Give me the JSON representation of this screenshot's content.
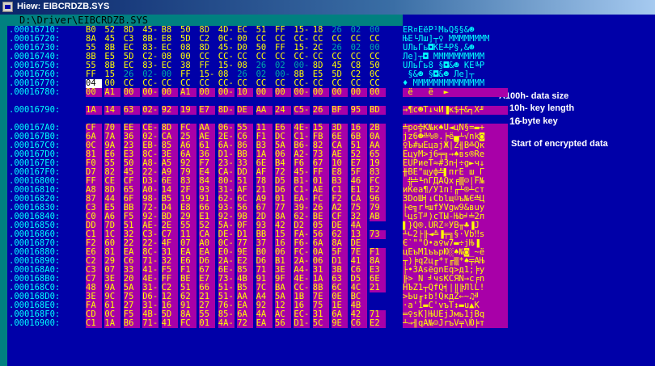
{
  "window": {
    "title": "Hiew: EIBCRDZB.SYS",
    "file_path": "D:\\Driver\\EIBCRDZB.SYS"
  },
  "colors": {
    "background": "#0000a8",
    "address": "#00ffff",
    "bytes": "#ffff00",
    "highlight": "#a800a8",
    "path_bar": "#008080"
  },
  "rows": [
    {
      "addr": ".00016710:",
      "bytes": [
        "B0",
        "52",
        "8D",
        "45-",
        "B8",
        "50",
        "8D",
        "4D-",
        "EC",
        "51",
        "FF",
        "15-",
        "18",
        "26",
        "02",
        "00"
      ],
      "dim": [
        13,
        14,
        15
      ],
      "ascii": "ЁR¤EёP¹MьQ§§&☻",
      "hl": false
    },
    {
      "addr": ".00016720:",
      "bytes": [
        "8A",
        "45",
        "C3",
        "8B-",
        "E8",
        "5D",
        "C2",
        "0C-",
        "00",
        "CC",
        "CC",
        "CC-",
        "CC",
        "CC",
        "CC",
        "CC"
      ],
      "dim": [],
      "ascii": "ЊE└Лш]┬♀ ММММММММ",
      "hl": false
    },
    {
      "addr": ".00016730:",
      "bytes": [
        "55",
        "8B",
        "EC",
        "83-",
        "EC",
        "08",
        "8D",
        "45-",
        "D0",
        "50",
        "FF",
        "15-",
        "2C",
        "26",
        "02",
        "00"
      ],
      "dim": [
        13,
        14,
        15
      ],
      "ascii": "UЛьГь◘ЌE╨P§,&☻",
      "hl": false
    },
    {
      "addr": ".00016740:",
      "bytes": [
        "8B",
        "E5",
        "5D",
        "C2-",
        "08",
        "00",
        "CC",
        "CC-",
        "CC",
        "CC",
        "CC",
        "CC-",
        "CC",
        "CC",
        "CC",
        "CC"
      ],
      "dim": [],
      "ascii": "Лe]┬◘ ММММММММММ",
      "hl": false
    },
    {
      "addr": ".00016750:",
      "bytes": [
        "55",
        "8B",
        "EC",
        "83-",
        "EC",
        "38",
        "FF",
        "15-",
        "08",
        "26",
        "02",
        "00-",
        "8D",
        "45",
        "C8",
        "50"
      ],
      "dim": [
        9,
        10,
        11
      ],
      "ascii": "UЛьГь8 §◘&☻ ЌE╚P",
      "hl": false
    },
    {
      "addr": ".00016760:",
      "bytes": [
        "FF",
        "15",
        "26",
        "02-",
        "00",
        "FF",
        "15-",
        "08",
        "26",
        "02",
        "00-",
        "8B",
        "E5",
        "5D",
        "C2",
        "0C"
      ],
      "dim": [
        2,
        3,
        4,
        8,
        9,
        10
      ],
      "ascii": " §&☻ §◘&☻ Лe]┬",
      "hl": false
    },
    {
      "addr": ".00016770:",
      "bytes": [
        "04",
        "00",
        "CC",
        "CC-",
        "CC",
        "CC",
        "CC",
        "CC-",
        "CC",
        "CC",
        "CC",
        "CC-",
        "CC",
        "CC",
        "CC",
        "CC"
      ],
      "dim": [],
      "cursor": 0,
      "ascii": "♦ ММММММММММММММ",
      "hl": false
    },
    {
      "addr": ".00016780:",
      "bytes": [
        "00",
        "A1",
        "00",
        "00-",
        "00",
        "A1",
        "00",
        "00-",
        "10",
        "00",
        "00",
        "00-",
        "00",
        "00",
        "00",
        "00"
      ],
      "dim": [],
      "ascii": " ё   ё  ►       ",
      "hl": true
    },
    {
      "addr": ".00016790:",
      "bytes": [
        "1A",
        "14",
        "63",
        "02-",
        "92",
        "19",
        "E7",
        "8D-",
        "DE",
        "AA",
        "24",
        "C5-",
        "26",
        "BF",
        "95",
        "BD"
      ],
      "dim": [],
      "ascii": "→¶c☻Т↓чЍ▐к$┼&┐Х╜",
      "hl": true,
      "gap": true
    },
    {
      "addr": ".000167A0:",
      "bytes": [
        "CF",
        "70",
        "EE",
        "CE-",
        "8D",
        "FC",
        "AA",
        "06-",
        "55",
        "11",
        "E6",
        "4E-",
        "15",
        "3D",
        "16",
        "2B"
      ],
      "dim": [],
      "ascii": "╧po╬Ќ№к♠U◄цN§=▬+",
      "hl": true,
      "gap": true
    },
    {
      "addr": ".000167B0:",
      "bytes": [
        "6A",
        "7A",
        "36",
        "02-",
        "CA",
        "25",
        "AE",
        "2E-",
        "C6",
        "F1",
        "DC",
        "C1-",
        "FB",
        "6E",
        "6B",
        "0A"
      ],
      "dim": [],
      "ascii": "jz6☻╩%®.╞ё▄┴√nk◙",
      "hl": true
    },
    {
      "addr": ".000167C0:",
      "bytes": [
        "0C",
        "9A",
        "23",
        "EB-",
        "85",
        "A6",
        "61",
        "6A-",
        "86",
        "B3",
        "5A",
        "B6-",
        "82",
        "CA",
        "51",
        "AA"
      ],
      "dim": [],
      "ascii": "♀Ъ#ыЕцajЖ│Z╢В╩Qк",
      "hl": true
    },
    {
      "addr": ".000167D0:",
      "bytes": [
        "81",
        "E6",
        "E3",
        "8C-",
        "3E",
        "6A",
        "36",
        "D1-",
        "BB",
        "1A",
        "06",
        "A2-",
        "73",
        "AE",
        "52",
        "65"
      ],
      "dim": [],
      "ascii": "ЁцуМ>j6╤╗→♠вs®Re",
      "hl": true
    },
    {
      "addr": ".000167E0:",
      "bytes": [
        "F0",
        "55",
        "50",
        "A8-",
        "A5",
        "92",
        "F7",
        "23-",
        "33",
        "6E",
        "B4",
        "F6",
        "67",
        "10",
        "E7",
        "19"
      ],
      "dim": [],
      "ascii": "ЁUPиеТ≈#3n┤÷g►ч↓",
      "hl": true
    },
    {
      "addr": ".000167F0:",
      "bytes": [
        "D7",
        "82",
        "45",
        "22-",
        "A9",
        "79",
        "E4",
        "CA-",
        "DD",
        "AF",
        "72",
        "45-",
        "FF",
        "E8",
        "5F",
        "83"
      ],
      "dim": [],
      "ascii": "╫ВE\"щyф╩▌пrE ш_Г",
      "hl": true
    },
    {
      "addr": ".00016800:",
      "bytes": [
        "FF",
        "CE",
        "CF",
        "D3-",
        "6E",
        "83",
        "84",
        "80-",
        "51",
        "78",
        "D5",
        "B1-",
        "01",
        "B3",
        "46",
        "FC"
      ],
      "dim": [],
      "ascii": " ╬╧╙nГДАQx╒▒☺│F№",
      "hl": true
    },
    {
      "addr": ".00016810:",
      "bytes": [
        "A8",
        "8D",
        "65",
        "A0-",
        "14",
        "2F",
        "93",
        "31-",
        "AF",
        "21",
        "D6",
        "C1-",
        "AE",
        "C1",
        "E1",
        "E2"
      ],
      "dim": [],
      "ascii": "иЌeа¶/У1п!╓┴®┴ст",
      "hl": true
    },
    {
      "addr": ".00016820:",
      "bytes": [
        "87",
        "44",
        "6F",
        "98-",
        "B5",
        "19",
        "91",
        "62-",
        "6C",
        "A9",
        "01",
        "EA-",
        "FC",
        "F2",
        "CA",
        "96"
      ],
      "dim": [],
      "ascii": "ЗDoШ╡↓Сblщ☺ъ№Є╩Ц",
      "hl": true
    },
    {
      "addr": ".00016830:",
      "bytes": [
        "C3",
        "E5",
        "BB",
        "72-",
        "D4",
        "E8",
        "66",
        "93-",
        "56",
        "67",
        "77",
        "39-",
        "26",
        "A2",
        "75",
        "79"
      ],
      "dim": [],
      "ascii": "├e╗r╘шfУVgw9&вuy",
      "hl": true
    },
    {
      "addr": ".00016840:",
      "bytes": [
        "C0",
        "A6",
        "F5",
        "92-",
        "BD",
        "29",
        "E1",
        "92-",
        "9B",
        "2D",
        "8A",
        "62-",
        "BE",
        "CF",
        "32",
        "AB"
      ],
      "dim": [],
      "ascii": "└цѕТ╜)сТЫ-Њb╛╧2л",
      "hl": true
    },
    {
      "addr": ".00016850:",
      "bytes": [
        "DD",
        "7D",
        "51",
        "AE-",
        "2E",
        "55",
        "52",
        "5A-",
        "0F",
        "93",
        "42",
        "D2",
        "05",
        "DE",
        "4A"
      ],
      "dim": [],
      "ascii": "▌}Q®.URZ☼УB╥♣▐J",
      "hl": true
    },
    {
      "addr": ".00016860:",
      "bytes": [
        "C1",
        "1C",
        "32",
        "C3-",
        "C7",
        "11",
        "CA",
        "DE-",
        "D1",
        "BB",
        "15",
        "FA-",
        "56",
        "62",
        "13",
        "73"
      ],
      "dim": [],
      "ascii": "┴∟2├╟◄╩▐╤╗§·Vb‼s",
      "hl": true
    },
    {
      "addr": ".00016870:",
      "bytes": [
        "F2",
        "60",
        "22",
        "22-",
        "4F",
        "07",
        "A0",
        "0C-",
        "77",
        "37",
        "16",
        "F6-",
        "6A",
        "8A",
        "DE"
      ],
      "dim": [],
      "ascii": "Є`\"\"O•а♀w7▬÷jЊ▐",
      "hl": true
    },
    {
      "addr": ".00016880:",
      "bytes": [
        "E6",
        "81",
        "EA",
        "8C-",
        "31",
        "EA",
        "EA",
        "E0-",
        "9E",
        "B0",
        "06",
        "FC-",
        "0A",
        "5F",
        "7E",
        "F1"
      ],
      "dim": [],
      "ascii": "цЁъМ1ъърЮ░♠№◙_~ё",
      "hl": true
    },
    {
      "addr": ".00016890:",
      "bytes": [
        "C2",
        "29",
        "C6",
        "71-",
        "32",
        "E6",
        "D6",
        "2A-",
        "E2",
        "D6",
        "B1",
        "2A-",
        "06",
        "D1",
        "41",
        "8A"
      ],
      "dim": [],
      "ascii": "┬)╞q2ц╓*т╓▒*♠╤AЊ",
      "hl": true
    },
    {
      "addr": ".000168A0:",
      "bytes": [
        "C3",
        "07",
        "33",
        "41-",
        "F5",
        "F1",
        "67",
        "6E-",
        "85",
        "71",
        "3E",
        "A4-",
        "31",
        "3B",
        "C6",
        "E3"
      ],
      "dim": [],
      "ascii": "├•3AѕёgnЕq>д1;╞у",
      "hl": true
    },
    {
      "addr": ".000168B0:",
      "bytes": [
        "C7",
        "3E",
        "20",
        "4E-",
        "FF",
        "BE",
        "E7",
        "73-",
        "4B",
        "91",
        "9F",
        "4E-",
        "1A",
        "63",
        "D5",
        "6E"
      ],
      "dim": [],
      "ascii": "╟> N ╛чsKСЯN→c╒n",
      "hl": true
    },
    {
      "addr": ".000168C0:",
      "bytes": [
        "48",
        "9A",
        "5A",
        "31-",
        "C2",
        "51",
        "66",
        "51-",
        "B5",
        "7C",
        "BA",
        "CC-",
        "8B",
        "6C",
        "4C",
        "21"
      ],
      "dim": [],
      "ascii": "HЪZ1┬QfQ╡|║╠ЛlL!",
      "hl": true
    },
    {
      "addr": ".000168D0:",
      "bytes": [
        "3E",
        "9C",
        "75",
        "D6-",
        "12",
        "62",
        "21",
        "51-",
        "AA",
        "A4",
        "5A",
        "1B",
        "7E",
        "0E",
        "BC"
      ],
      "dim": [],
      "ascii": ">Ьu╓↕b!QкдZ←~♫╝",
      "hl": true
    },
    {
      "addr": ".000168E0:",
      "bytes": [
        "FA",
        "61",
        "27",
        "31-",
        "16",
        "91",
        "27",
        "76-",
        "EA",
        "92",
        "12",
        "16",
        "75",
        "1E",
        "4B"
      ],
      "dim": [],
      "ascii": "·a'1▬С'vъТ↕▬u▲K",
      "hl": true
    },
    {
      "addr": ".000168F0:",
      "bytes": [
        "CD",
        "0C",
        "F5",
        "4B-",
        "5D",
        "8A",
        "55",
        "85-",
        "6A",
        "4A",
        "AC",
        "EC-",
        "31",
        "6A",
        "42",
        "71"
      ],
      "dim": [],
      "ascii": "═♀ѕK]ЊUЕjJмь1jBq",
      "hl": true
    },
    {
      "addr": ".00016900:",
      "bytes": [
        "C1",
        "1A",
        "B6",
        "71-",
        "41",
        "FC",
        "01",
        "4A-",
        "72",
        "EA",
        "56",
        "D1-",
        "5C",
        "9E",
        "C6",
        "E2"
      ],
      "dim": [],
      "ascii": "┴→╢qA№☺JrъV╤\\Ю╞т",
      "hl": true
    }
  ],
  "annotations": {
    "data_size": "A100h- data size",
    "key_length": "10h- key length",
    "key_bytes_num": "16",
    "key_bytes_text": " -byte key",
    "encrypted": "Start of encrypted data"
  }
}
